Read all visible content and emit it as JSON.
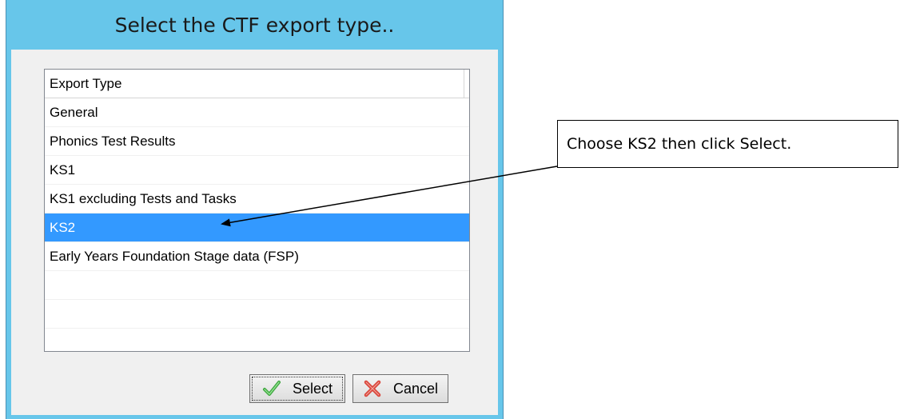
{
  "dialog": {
    "title": "Select the CTF export type..",
    "list": {
      "column_header": "Export Type",
      "items": [
        {
          "label": "General",
          "selected": false
        },
        {
          "label": "Phonics Test Results",
          "selected": false
        },
        {
          "label": "KS1",
          "selected": false
        },
        {
          "label": "KS1 excluding Tests and Tasks",
          "selected": false
        },
        {
          "label": "KS2",
          "selected": true
        },
        {
          "label": "Early Years Foundation Stage data (FSP)",
          "selected": false
        },
        {
          "label": "",
          "selected": false
        },
        {
          "label": "",
          "selected": false
        },
        {
          "label": "",
          "selected": false
        }
      ]
    },
    "buttons": {
      "select_label": "Select",
      "select_icon": "green-checkmark-icon",
      "cancel_label": "Cancel",
      "cancel_icon": "red-x-icon"
    }
  },
  "annotation": {
    "callout_text": "Choose KS2 then click Select."
  },
  "colors": {
    "titlebar": "#67c6ea",
    "selection": "#3399ff",
    "check_green": "#3aa33a",
    "cancel_red": "#d9453a"
  }
}
